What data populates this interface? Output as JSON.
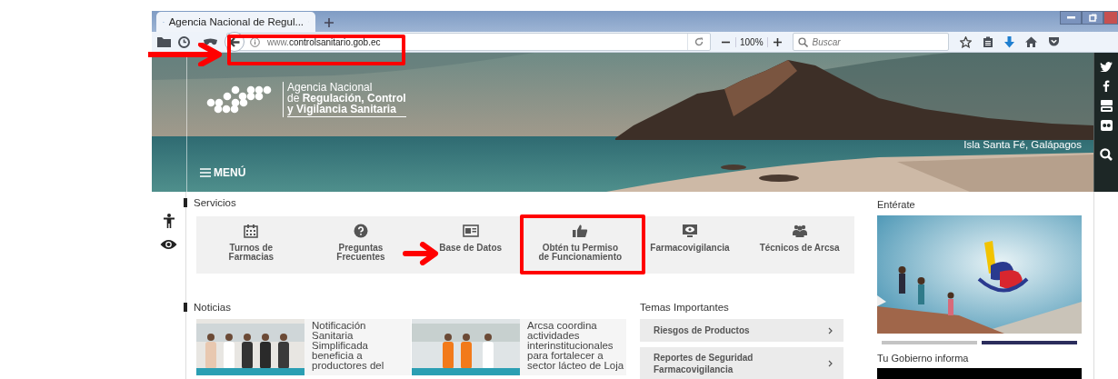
{
  "browser": {
    "tab": {
      "title": "Agencia Nacional de Regul...",
      "selected": true
    },
    "url": {
      "prefix": "www.",
      "domain": "controlsanitario.gob.ec"
    },
    "zoom_level": "100%",
    "search": {
      "placeholder": "Buscar"
    }
  },
  "hero": {
    "logo": [
      "Agencia Nacional",
      "de **Regulación, Control**",
      "y Vigilancia Sanitaria"
    ],
    "menu": "MENÚ",
    "caption": "Isla Santa Fé, Galápagos"
  },
  "servicios": {
    "title": "Servicios",
    "items": [
      {
        "label": "Turnos de\nFarmacias"
      },
      {
        "label": "Preguntas\nFrecuentes"
      },
      {
        "label": "Base de Datos"
      },
      {
        "label": "Obtén tu Permiso\nde Funcionamiento"
      },
      {
        "label": "Farmacovigilancia"
      },
      {
        "label": "Técnicos de Arcsa"
      }
    ]
  },
  "noticias": {
    "title": "Noticias",
    "items": [
      {
        "title": "Notificación\nSanitaria\nSimplificada\nbeneficia a\nproductores del"
      },
      {
        "title": "Arcsa coordina\nactividades\ninterinstitucionales\npara fortalecer a\nsector lácteo de Loja"
      }
    ]
  },
  "temas": {
    "title": "Temas Importantes",
    "items": [
      {
        "label": "Riesgos de Productos"
      },
      {
        "label": "Reportes de Seguridad\nFarmacovigilancia"
      }
    ]
  },
  "enterate": {
    "title": "Entérate",
    "slides": [
      {
        "selected": false
      },
      {
        "selected": true
      }
    ]
  },
  "gobierno": {
    "title": "Tu Gobierno informa"
  }
}
